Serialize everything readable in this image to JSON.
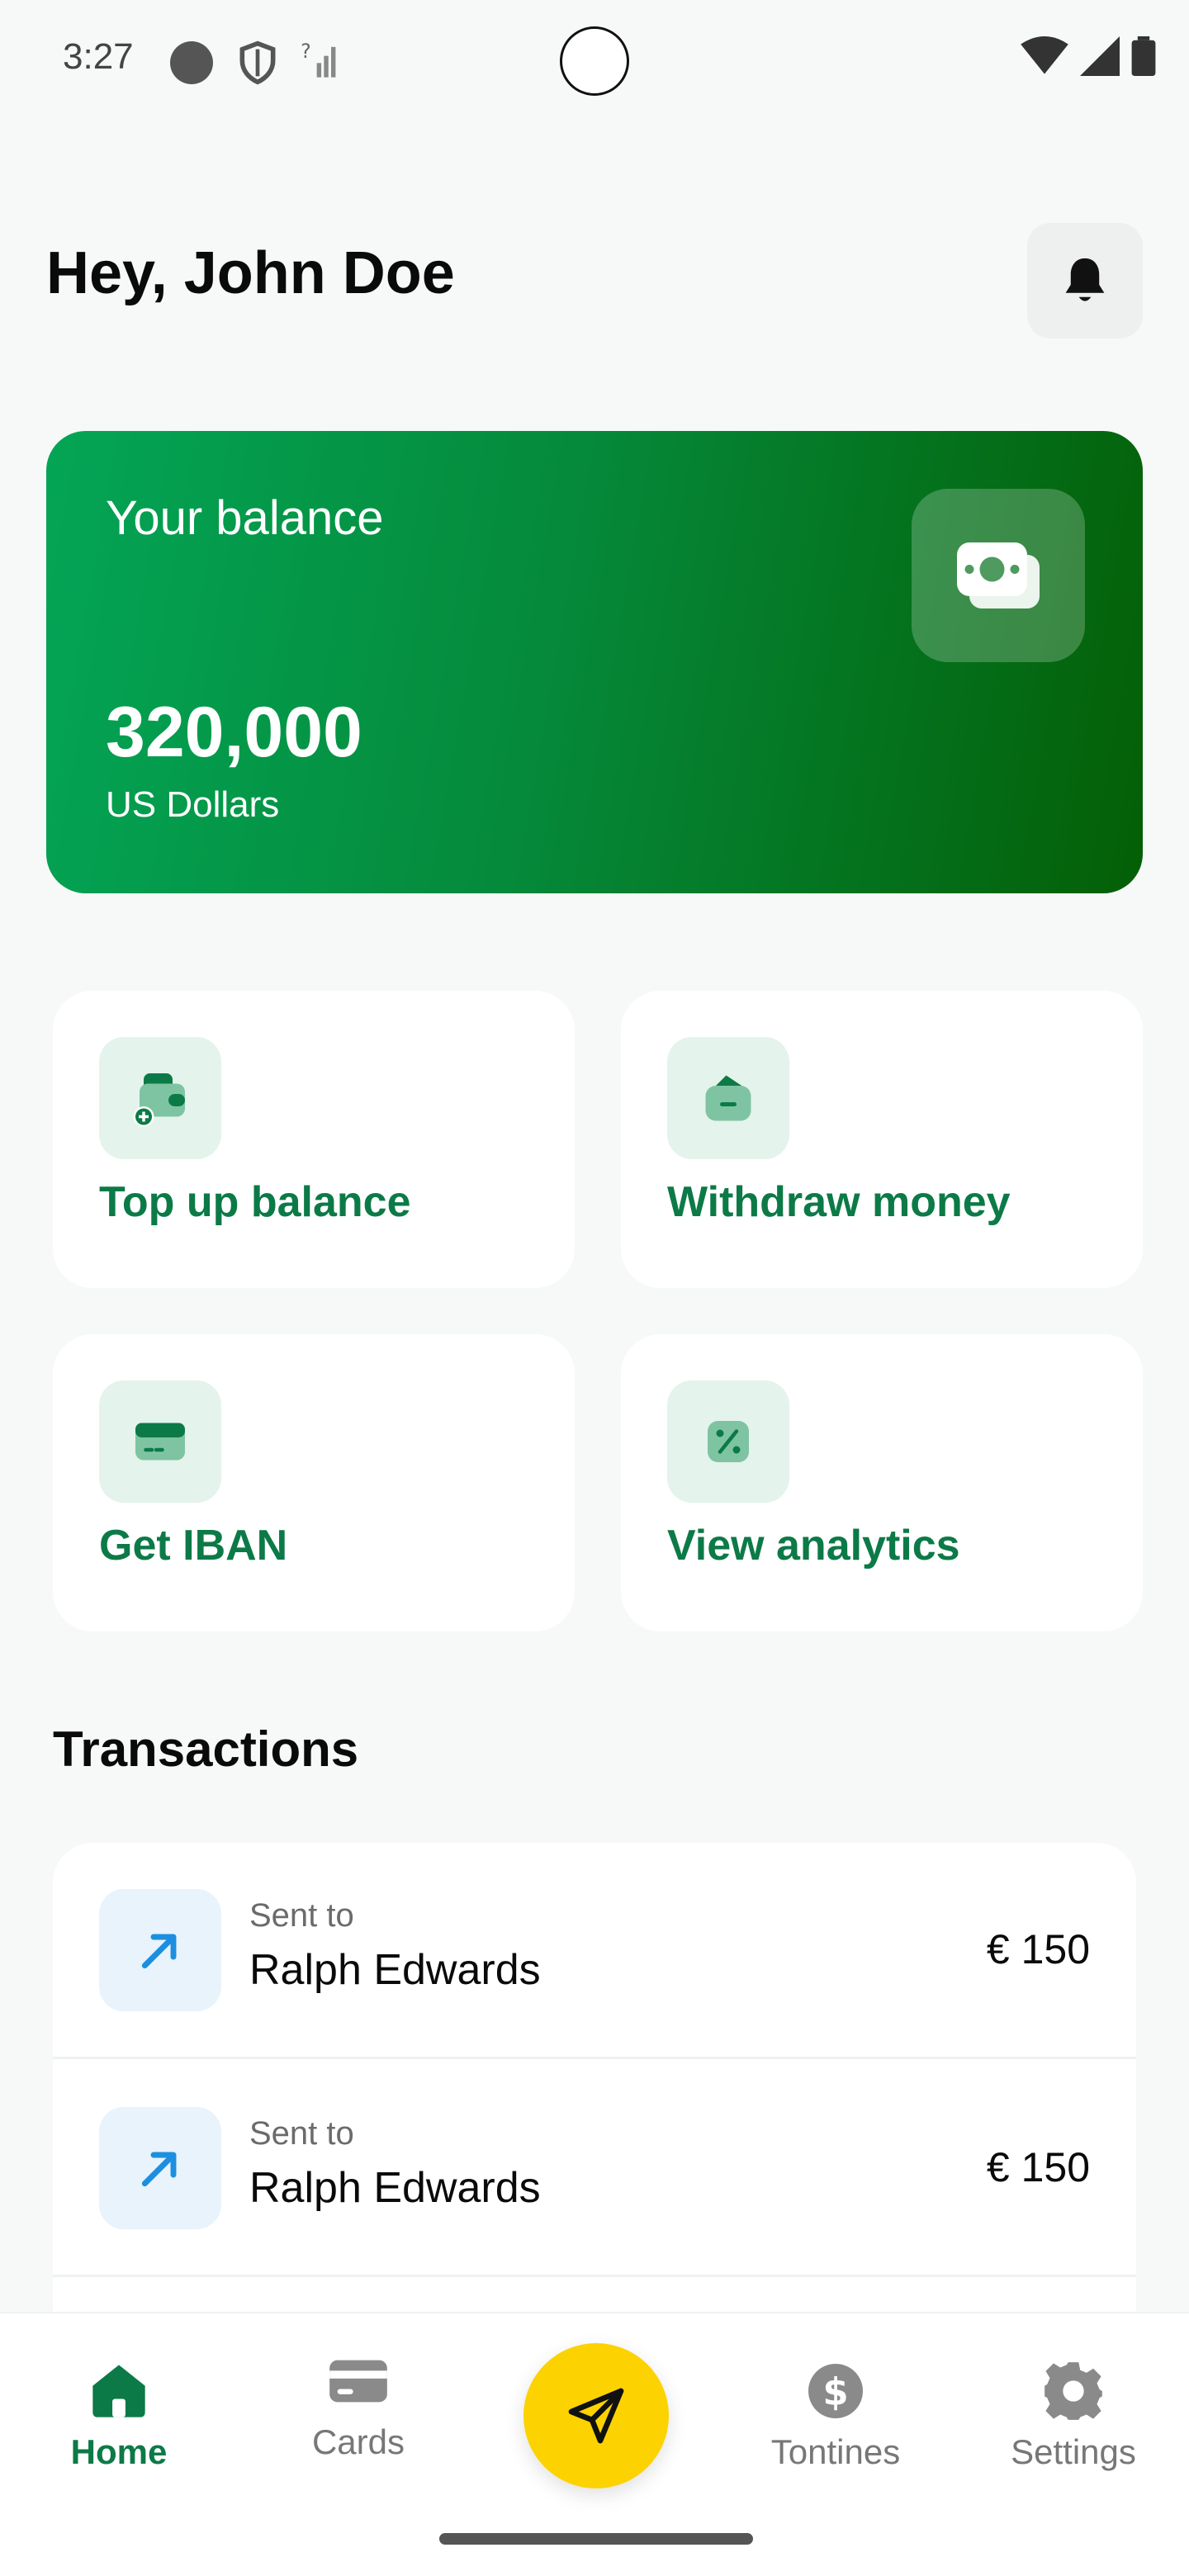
{
  "status_bar": {
    "time": "3:27"
  },
  "header": {
    "greeting": "Hey, John Doe",
    "notification_icon": "bell-icon"
  },
  "balance": {
    "label": "Your balance",
    "amount": "320,000",
    "currency": "US Dollars",
    "icon": "money-icon"
  },
  "actions": [
    {
      "label": "Top up balance",
      "icon": "wallet-add-icon"
    },
    {
      "label": "Withdraw money",
      "icon": "wallet-remove-icon"
    },
    {
      "label": "Get IBAN",
      "icon": "card-icon"
    },
    {
      "label": "View analytics",
      "icon": "percent-icon"
    }
  ],
  "transactions": {
    "title": "Transactions",
    "items": [
      {
        "sub": "Sent to",
        "name": "Ralph Edwards",
        "amount": "€ 150",
        "icon": "arrow-up-right-icon"
      },
      {
        "sub": "Sent to",
        "name": "Ralph Edwards",
        "amount": "€ 150",
        "icon": "arrow-up-right-icon"
      }
    ]
  },
  "nav": {
    "items": [
      {
        "label": "Home",
        "icon": "home-icon",
        "active": true
      },
      {
        "label": "Cards",
        "icon": "card-icon"
      },
      {
        "label": "Tontines",
        "icon": "dollar-icon"
      },
      {
        "label": "Settings",
        "icon": "gear-icon"
      }
    ],
    "fab_icon": "send-icon"
  },
  "colors": {
    "accent": "#0c7a47",
    "fab": "#fcd200",
    "card_start": "#04a556",
    "card_end": "#045f06"
  }
}
